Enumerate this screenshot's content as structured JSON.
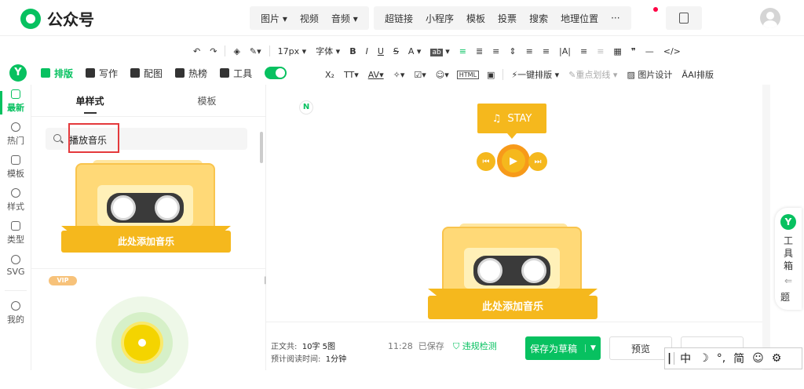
{
  "header": {
    "brand": "公众号",
    "menu_group1": [
      "图片",
      "视频",
      "音频"
    ],
    "menu_group2": [
      "超链接",
      "小程序",
      "模板",
      "投票",
      "搜索",
      "地理位置"
    ],
    "more": "···"
  },
  "toolbar1": {
    "font_size": "17px",
    "font_family": "字体",
    "items": [
      "B",
      "I",
      "U",
      "S",
      "A",
      "ab",
      "≡",
      "≣",
      "≡",
      "⇕",
      "≡",
      "≡",
      "|A|",
      "≡",
      "≡",
      "▦",
      "❞",
      "—",
      "</>"
    ]
  },
  "toolbar2": {
    "sub": "X₂",
    "tt": "TT",
    "av": "AV",
    "html": "HTML",
    "onekey": "一键排版",
    "emphasis": "重点划线",
    "img_design": "图片设计",
    "ai": "AI排版"
  },
  "tabs": [
    {
      "label": "排版",
      "icon": "layout-icon"
    },
    {
      "label": "写作",
      "icon": "pen-icon"
    },
    {
      "label": "配图",
      "icon": "image-icon"
    },
    {
      "label": "热榜",
      "icon": "bookmark-icon"
    },
    {
      "label": "工具",
      "icon": "cube-icon"
    }
  ],
  "sidebar": {
    "items": [
      {
        "label": "最新",
        "icon": "chat-icon"
      },
      {
        "label": "热门",
        "icon": "flame-icon"
      },
      {
        "label": "模板",
        "icon": "template-icon"
      },
      {
        "label": "样式",
        "icon": "style-icon"
      },
      {
        "label": "类型",
        "icon": "type-icon"
      },
      {
        "label": "SVG",
        "icon": "svg-icon"
      },
      {
        "label": "我的",
        "icon": "user-icon"
      }
    ]
  },
  "panel": {
    "tab_single": "单样式",
    "tab_template": "模板",
    "search_value": "播放音乐",
    "vip": "VIP",
    "cassette_label": "此处添加音乐"
  },
  "editor": {
    "song_title": "STAY",
    "cassette_label": "此处添加音乐"
  },
  "bottom": {
    "word_count_label": "正文共:",
    "word_count_value": "10字 5图",
    "read_time_label": "预计阅读时间:",
    "read_time_value": "1分钟",
    "saved_time": "11:28",
    "saved_status": "已保存",
    "check": "违规检测",
    "save_draft": "保存为草稿",
    "preview": "预览"
  },
  "toolbox": {
    "label": "工具箱",
    "extra": "题"
  },
  "ime": [
    "中",
    "☽",
    "°,",
    "简",
    "☺",
    "⚙"
  ],
  "colors": {
    "brand_green": "#07c160",
    "cassette_gold": "#f5b81d",
    "highlight_red": "#e4393c"
  }
}
